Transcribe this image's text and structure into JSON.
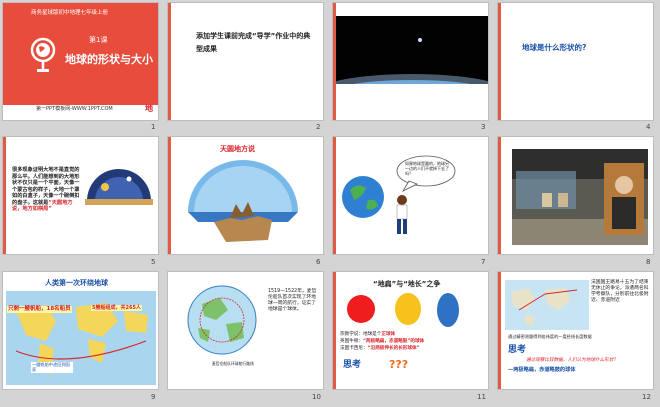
{
  "slides": [
    {
      "number": "1",
      "header": "商务星球版初中地理七年级上册",
      "lesson": "第1课",
      "title": "地球的形状与大小",
      "footer": "第一PPT模板网-WWW.1PPT.COM",
      "corner": "地"
    },
    {
      "number": "2",
      "text": "添加学生课前完成“导学”作业中的典型成果"
    },
    {
      "number": "3"
    },
    {
      "number": "4",
      "text": "地球是什么形状的?"
    },
    {
      "number": "5",
      "text_dark": "很多现象证明大地不是直觉的那么平。人们能想到的大地形状不仅只是一个平面，天像一个蒙古包的样子，大地一个罩如的白盒子，天像一个碗倒扣的盘子。这就是",
      "text_red": "“天圆地方说，地方如棋局”"
    },
    {
      "number": "6",
      "title": "天圆地方说"
    },
    {
      "number": "7",
      "bubble": "如果地球是圆的，地球另一边的人们不就掉下去了吗？"
    },
    {
      "number": "8"
    },
    {
      "number": "9",
      "title": "人类第一次环绕地球",
      "label_a": "只剩一艘帆船，18名船员",
      "label_b": "5艘船组成，共265人",
      "label_c": "一艘帆船中途回到国家"
    },
    {
      "number": "10",
      "text": "1519—1522年，麦哲伦船队首次实现了环地球一周的航行，证实了地球是个球体。",
      "caption": "麦哲伦船队环球航行路线"
    },
    {
      "number": "11",
      "title": "“地扁”与“地长”之争",
      "line1_label": "宗教学说：地球是个",
      "line1_value": "正球体",
      "line2_label": "英国牛顿：",
      "line2_value": "“两极略扁，赤道略鼓”的球体",
      "line3_label": "法国卡西尼：",
      "line3_value": "“沿两极伸长的长形球体”",
      "think": "思考",
      "qmarks": "???"
    },
    {
      "number": "12",
      "text": "法国国王路易十五为了结束无休止的争论，派遣两名科学考察队，分别前往北极附近、赤道附近",
      "text2": "通过精密测量得到各纬度的一度经线长度数据",
      "think": "思考",
      "q": "通过观察比较数据，人们认为地球什么形状？",
      "answer": "—两极略扁，赤道略鼓的球体"
    }
  ],
  "colors": {
    "accent_red": "#d8262c",
    "slide_bg": "#ffffff",
    "canvas_bg": "#d4d4d4"
  }
}
